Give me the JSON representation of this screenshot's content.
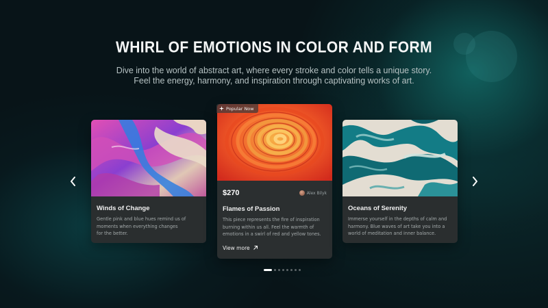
{
  "hero": {
    "title": "WHIRL OF EMOTIONS IN COLOR AND FORM",
    "subtitle_line1": "Dive into the world of abstract art, where every stroke and color tells a unique story.",
    "subtitle_line2": "Feel the energy, harmony, and inspiration through captivating works of art."
  },
  "carousel": {
    "prev_icon": "chevron-left-icon",
    "next_icon": "chevron-right-icon",
    "dots_count": 8,
    "active_dot": 1
  },
  "cards": {
    "left": {
      "title": "Winds of Change",
      "description": "Gentle pink and blue hues remind us of\nmoments when everything changes\n for the better."
    },
    "center": {
      "badge": "Popular Now",
      "badge_icon": "sparkle-icon",
      "price": "$270",
      "author": "Alex Bilyk",
      "title": "Flames of Passion",
      "description": "This piece represents the fire of inspiration\nburning within us all. Feel the warmth of\nemotions in a swirl of red and yellow tones.",
      "cta": "View more",
      "cta_icon": "arrow-up-right-icon"
    },
    "right": {
      "title": "Oceans of Serenity",
      "description": "Immerse yourself in the depths of calm and\nharmony. Blue waves of art take you into a\nworld of meditation and inner balance."
    }
  },
  "colors": {
    "background": "#081418",
    "card": "#2b2f30",
    "accent_teal": "#14787a"
  }
}
